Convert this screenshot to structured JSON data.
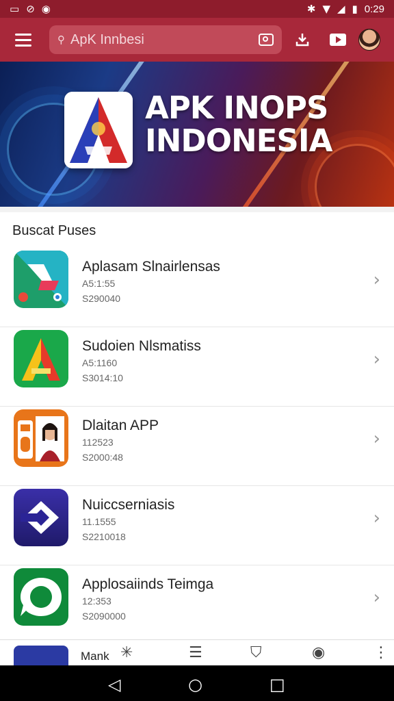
{
  "status": {
    "time": "0:29",
    "icons": [
      "sim-icon",
      "wifi-off-icon",
      "circle-icon",
      "bluetooth-icon",
      "wifi-icon",
      "signal-icon",
      "battery-icon"
    ]
  },
  "header": {
    "search_text": "ApK Innbesi"
  },
  "banner": {
    "title_line1": "APK INOPS",
    "title_line2": "INDONESIA"
  },
  "list": {
    "title": "Buscat Puses",
    "items": [
      {
        "name": "Aplasam Slnairlensas",
        "line2": "A5:1:55",
        "line3": "S290040"
      },
      {
        "name": "Sudoien Nlsmatiss",
        "line2": "A5:1160",
        "line3": "S3014:10"
      },
      {
        "name": "Dlaitan APP",
        "line2": "112523",
        "line3": "S2000:48"
      },
      {
        "name": "Nuiccserniasis",
        "line2": "11.1555",
        "line3": "S2210018"
      },
      {
        "name": "Applosaiinds Teimga",
        "line2": "12:353",
        "line3": "S2090000"
      }
    ]
  },
  "bottom": {
    "label": "Mank"
  },
  "colors": {
    "primary": "#a8283a",
    "statusbar": "#8e1c2c"
  }
}
